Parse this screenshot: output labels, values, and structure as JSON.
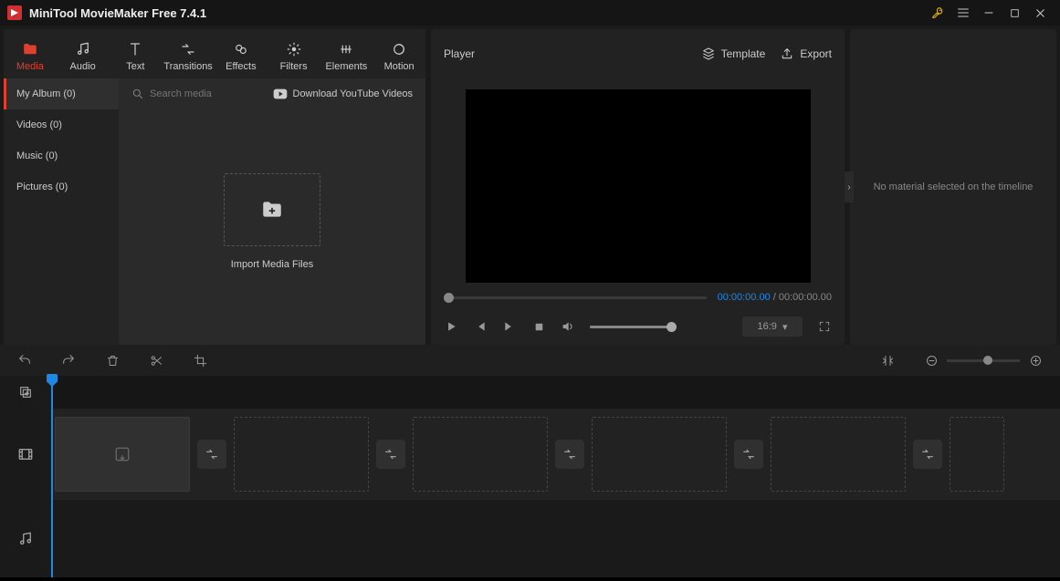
{
  "titlebar": {
    "title": "MiniTool MovieMaker Free 7.4.1"
  },
  "tabs": {
    "media": "Media",
    "audio": "Audio",
    "text": "Text",
    "transitions": "Transitions",
    "effects": "Effects",
    "filters": "Filters",
    "elements": "Elements",
    "motion": "Motion"
  },
  "media_sidebar": {
    "my_album": "My Album (0)",
    "videos": "Videos (0)",
    "music": "Music (0)",
    "pictures": "Pictures (0)"
  },
  "media_browser": {
    "search_placeholder": "Search media",
    "youtube": "Download YouTube Videos",
    "import_label": "Import Media Files"
  },
  "player": {
    "title": "Player",
    "template": "Template",
    "export": "Export",
    "current_time": "00:00:00.00",
    "total_time": "00:00:00.00",
    "ratio": "16:9"
  },
  "inspector": {
    "empty": "No material selected on the timeline"
  }
}
